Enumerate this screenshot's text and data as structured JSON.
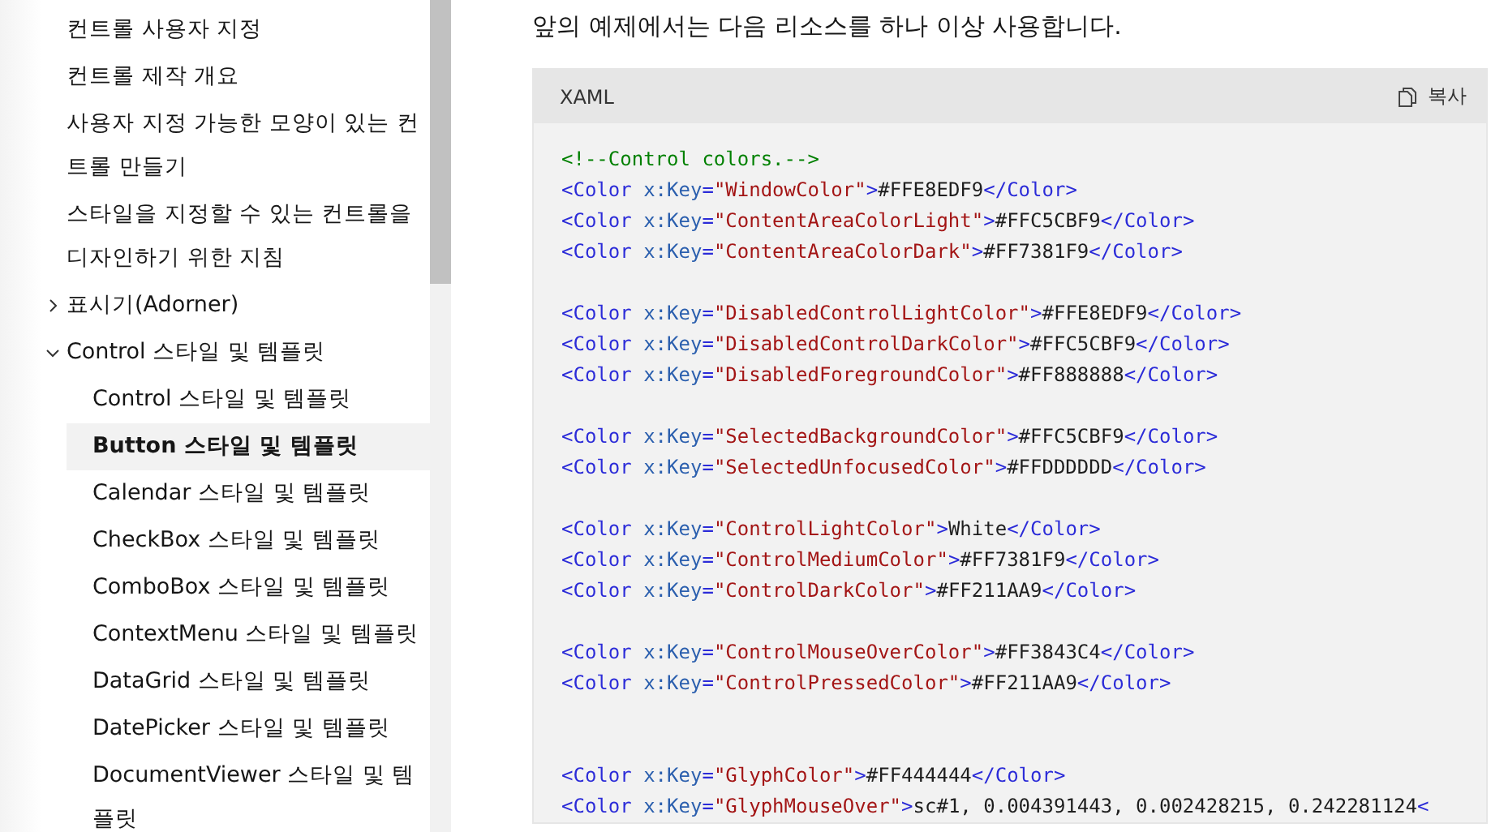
{
  "sidebar": {
    "items": [
      {
        "kind": "page",
        "label": "컨트롤 사용자 지정",
        "selected": false
      },
      {
        "kind": "page",
        "label": "컨트롤 제작 개요",
        "selected": false
      },
      {
        "kind": "page",
        "label": "사용자 지정 가능한 모양이 있는 컨트롤 만들기",
        "selected": false
      },
      {
        "kind": "page",
        "label": "스타일을 지정할 수 있는 컨트롤을 디자인하기 위한 지침",
        "selected": false
      },
      {
        "kind": "folder",
        "label": "표시기(Adorner)",
        "selected": false,
        "expanded": false
      },
      {
        "kind": "folder",
        "label": "Control 스타일 및 템플릿",
        "selected": false,
        "expanded": true,
        "children": [
          {
            "kind": "page",
            "label": "Control 스타일 및 템플릿",
            "selected": false
          },
          {
            "kind": "page",
            "label": "Button 스타일 및 템플릿",
            "selected": true
          },
          {
            "kind": "page",
            "label": "Calendar 스타일 및 템플릿",
            "selected": false
          },
          {
            "kind": "page",
            "label": "CheckBox 스타일 및 템플릿",
            "selected": false
          },
          {
            "kind": "page",
            "label": "ComboBox 스타일 및 템플릿",
            "selected": false
          },
          {
            "kind": "page",
            "label": "ContextMenu 스타일 및 템플릿",
            "selected": false
          },
          {
            "kind": "page",
            "label": "DataGrid 스타일 및 템플릿",
            "selected": false
          },
          {
            "kind": "page",
            "label": "DatePicker 스타일 및 템플릿",
            "selected": false
          },
          {
            "kind": "page",
            "label": "DocumentViewer 스타일 및 템플릿",
            "selected": false
          }
        ]
      }
    ]
  },
  "intro": "앞의 예제에서는 다음 리소스를 하나 이상 사용합니다.",
  "code_block": {
    "language": "XAML",
    "copy_label": "복사",
    "groups": [
      {
        "kind": "normal",
        "lines": [
          [
            {
              "kind": "comment",
              "text": "<!--Control colors.-->"
            }
          ],
          [
            {
              "kind": "tag",
              "text": "<Color "
            },
            {
              "kind": "attr",
              "text": "x:Key"
            },
            {
              "kind": "tag",
              "text": "="
            },
            {
              "kind": "string",
              "text": "\"WindowColor\""
            },
            {
              "kind": "tag",
              "text": ">"
            },
            {
              "kind": "plain",
              "text": "#FFE8EDF9"
            },
            {
              "kind": "tag",
              "text": "</Color>"
            }
          ],
          [
            {
              "kind": "tag",
              "text": "<Color "
            },
            {
              "kind": "attr",
              "text": "x:Key"
            },
            {
              "kind": "tag",
              "text": "="
            },
            {
              "kind": "string",
              "text": "\"ContentAreaColorLight\""
            },
            {
              "kind": "tag",
              "text": ">"
            },
            {
              "kind": "plain",
              "text": "#FFC5CBF9"
            },
            {
              "kind": "tag",
              "text": "</Color>"
            }
          ],
          [
            {
              "kind": "tag",
              "text": "<Color "
            },
            {
              "kind": "attr",
              "text": "x:Key"
            },
            {
              "kind": "tag",
              "text": "="
            },
            {
              "kind": "string",
              "text": "\"ContentAreaColorDark\""
            },
            {
              "kind": "tag",
              "text": ">"
            },
            {
              "kind": "plain",
              "text": "#FF7381F9"
            },
            {
              "kind": "tag",
              "text": "</Color>"
            }
          ]
        ]
      },
      {
        "kind": "normal",
        "lines": [
          [
            {
              "kind": "tag",
              "text": "<Color "
            },
            {
              "kind": "attr",
              "text": "x:Key"
            },
            {
              "kind": "tag",
              "text": "="
            },
            {
              "kind": "string",
              "text": "\"DisabledControlLightColor\""
            },
            {
              "kind": "tag",
              "text": ">"
            },
            {
              "kind": "plain",
              "text": "#FFE8EDF9"
            },
            {
              "kind": "tag",
              "text": "</Color>"
            }
          ],
          [
            {
              "kind": "tag",
              "text": "<Color "
            },
            {
              "kind": "attr",
              "text": "x:Key"
            },
            {
              "kind": "tag",
              "text": "="
            },
            {
              "kind": "string",
              "text": "\"DisabledControlDarkColor\""
            },
            {
              "kind": "tag",
              "text": ">"
            },
            {
              "kind": "plain",
              "text": "#FFC5CBF9"
            },
            {
              "kind": "tag",
              "text": "</Color>"
            }
          ],
          [
            {
              "kind": "tag",
              "text": "<Color "
            },
            {
              "kind": "attr",
              "text": "x:Key"
            },
            {
              "kind": "tag",
              "text": "="
            },
            {
              "kind": "string",
              "text": "\"DisabledForegroundColor\""
            },
            {
              "kind": "tag",
              "text": ">"
            },
            {
              "kind": "plain",
              "text": "#FF888888"
            },
            {
              "kind": "tag",
              "text": "</Color>"
            }
          ]
        ]
      },
      {
        "kind": "normal",
        "lines": [
          [
            {
              "kind": "tag",
              "text": "<Color "
            },
            {
              "kind": "attr",
              "text": "x:Key"
            },
            {
              "kind": "tag",
              "text": "="
            },
            {
              "kind": "string",
              "text": "\"SelectedBackgroundColor\""
            },
            {
              "kind": "tag",
              "text": ">"
            },
            {
              "kind": "plain",
              "text": "#FFC5CBF9"
            },
            {
              "kind": "tag",
              "text": "</Color>"
            }
          ],
          [
            {
              "kind": "tag",
              "text": "<Color "
            },
            {
              "kind": "attr",
              "text": "x:Key"
            },
            {
              "kind": "tag",
              "text": "="
            },
            {
              "kind": "string",
              "text": "\"SelectedUnfocusedColor\""
            },
            {
              "kind": "tag",
              "text": ">"
            },
            {
              "kind": "plain",
              "text": "#FFDDDDDD"
            },
            {
              "kind": "tag",
              "text": "</Color>"
            }
          ]
        ]
      },
      {
        "kind": "normal",
        "lines": [
          [
            {
              "kind": "tag",
              "text": "<Color "
            },
            {
              "kind": "attr",
              "text": "x:Key"
            },
            {
              "kind": "tag",
              "text": "="
            },
            {
              "kind": "string",
              "text": "\"ControlLightColor\""
            },
            {
              "kind": "tag",
              "text": ">"
            },
            {
              "kind": "plain",
              "text": "White"
            },
            {
              "kind": "tag",
              "text": "</Color>"
            }
          ],
          [
            {
              "kind": "tag",
              "text": "<Color "
            },
            {
              "kind": "attr",
              "text": "x:Key"
            },
            {
              "kind": "tag",
              "text": "="
            },
            {
              "kind": "string",
              "text": "\"ControlMediumColor\""
            },
            {
              "kind": "tag",
              "text": ">"
            },
            {
              "kind": "plain",
              "text": "#FF7381F9"
            },
            {
              "kind": "tag",
              "text": "</Color>"
            }
          ],
          [
            {
              "kind": "tag",
              "text": "<Color "
            },
            {
              "kind": "attr",
              "text": "x:Key"
            },
            {
              "kind": "tag",
              "text": "="
            },
            {
              "kind": "string",
              "text": "\"ControlDarkColor\""
            },
            {
              "kind": "tag",
              "text": ">"
            },
            {
              "kind": "plain",
              "text": "#FF211AA9"
            },
            {
              "kind": "tag",
              "text": "</Color>"
            }
          ]
        ]
      },
      {
        "kind": "normal",
        "lines": [
          [
            {
              "kind": "tag",
              "text": "<Color "
            },
            {
              "kind": "attr",
              "text": "x:Key"
            },
            {
              "kind": "tag",
              "text": "="
            },
            {
              "kind": "string",
              "text": "\"ControlMouseOverColor\""
            },
            {
              "kind": "tag",
              "text": ">"
            },
            {
              "kind": "plain",
              "text": "#FF3843C4"
            },
            {
              "kind": "tag",
              "text": "</Color>"
            }
          ],
          [
            {
              "kind": "tag",
              "text": "<Color "
            },
            {
              "kind": "attr",
              "text": "x:Key"
            },
            {
              "kind": "tag",
              "text": "="
            },
            {
              "kind": "string",
              "text": "\"ControlPressedColor\""
            },
            {
              "kind": "tag",
              "text": ">"
            },
            {
              "kind": "plain",
              "text": "#FF211AA9"
            },
            {
              "kind": "tag",
              "text": "</Color>"
            }
          ]
        ]
      },
      {
        "kind": "wide",
        "lines": [
          [
            {
              "kind": "tag",
              "text": "<Color "
            },
            {
              "kind": "attr",
              "text": "x:Key"
            },
            {
              "kind": "tag",
              "text": "="
            },
            {
              "kind": "string",
              "text": "\"GlyphColor\""
            },
            {
              "kind": "tag",
              "text": ">"
            },
            {
              "kind": "plain",
              "text": "#FF444444"
            },
            {
              "kind": "tag",
              "text": "</Color>"
            }
          ],
          [
            {
              "kind": "tag",
              "text": "<Color "
            },
            {
              "kind": "attr",
              "text": "x:Key"
            },
            {
              "kind": "tag",
              "text": "="
            },
            {
              "kind": "string",
              "text": "\"GlyphMouseOver\""
            },
            {
              "kind": "tag",
              "text": ">"
            },
            {
              "kind": "plain",
              "text": "sc#1, 0.004391443, 0.002428215, 0.242281124"
            },
            {
              "kind": "tag",
              "text": "<"
            }
          ]
        ]
      }
    ]
  }
}
